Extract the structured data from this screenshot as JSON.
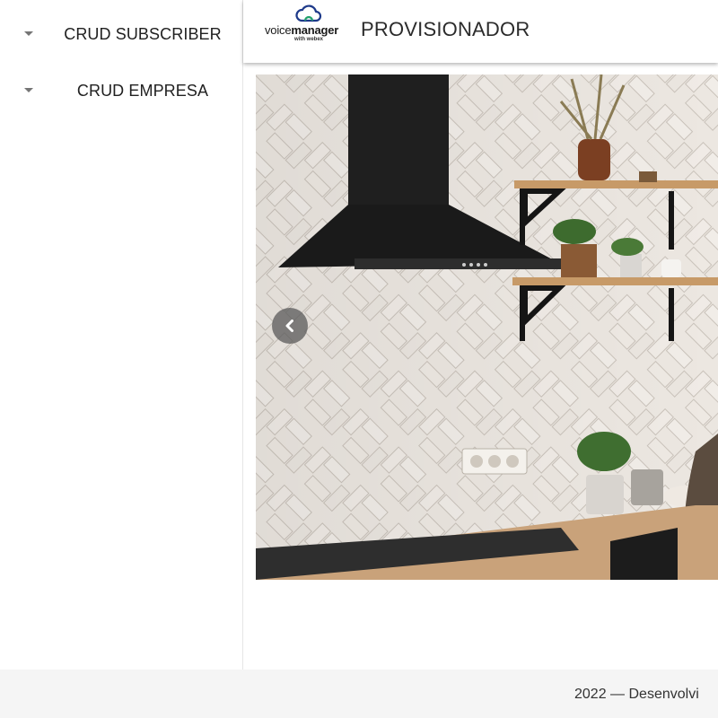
{
  "sidebar": {
    "items": [
      {
        "label": "CRUD SUBSCRIBER",
        "icon": "caret-down-icon"
      },
      {
        "label": "CRUD EMPRESA",
        "icon": "caret-down-icon"
      }
    ]
  },
  "header": {
    "logo": {
      "word_regular": "voice",
      "word_bold": "manager",
      "sub": "with webex",
      "icon": "cloud-icon"
    },
    "title": "PROVISIONADOR"
  },
  "carousel": {
    "image": "kitchen-herringbone-tile-photo",
    "prev_icon": "chevron-left-icon"
  },
  "footer": {
    "text": "2022 — Desenvolvi"
  },
  "colors": {
    "accent_cloud": "#1e3a8a",
    "accent_cloud_green": "#22a06b",
    "footer_bg": "#f5f5f5"
  }
}
